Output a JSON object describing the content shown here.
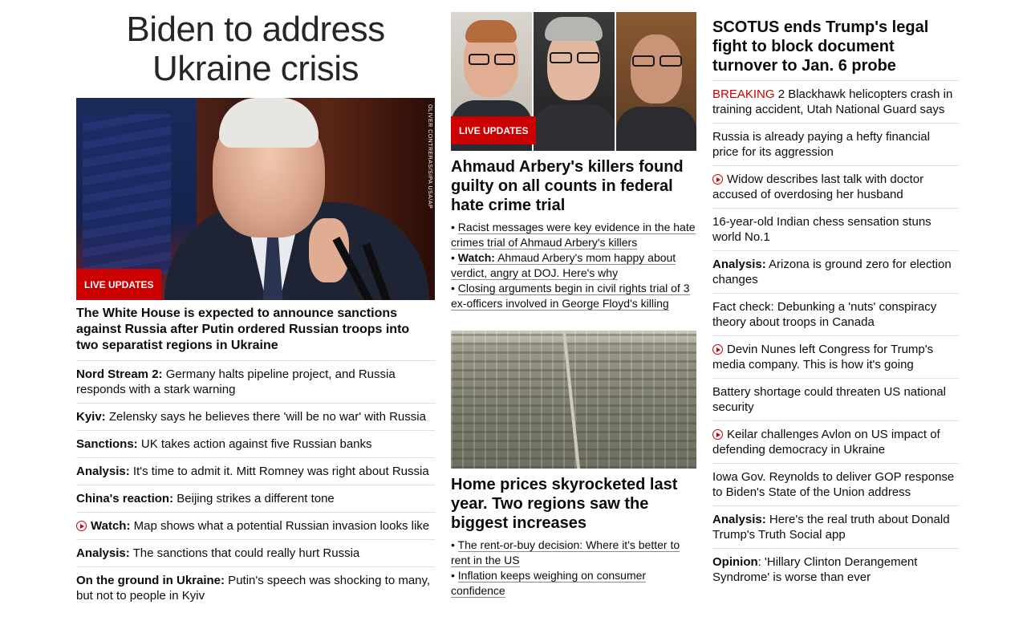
{
  "col1": {
    "title": "Biden to address Ukraine crisis",
    "image_credit": "OLIVER CONTRERAS/SIPA USA/AP",
    "badge": "LIVE UPDATES",
    "lead": "The White House is expected to announce sanctions against Russia after Putin ordered Russian troops into two separatist regions in Ukraine",
    "items": [
      {
        "label": "Nord Stream 2:",
        "text": " Germany halts pipeline project, and Russia responds with a stark warning",
        "video": false
      },
      {
        "label": "Kyiv:",
        "text": " Zelensky says he believes there 'will be no war' with Russia",
        "video": false
      },
      {
        "label": "Sanctions:",
        "text": " UK takes action against five Russian banks",
        "video": false
      },
      {
        "label": "Analysis:",
        "text": " It's time to admit it. Mitt Romney was right about Russia",
        "video": false
      },
      {
        "label": "China's reaction:",
        "text": " Beijing strikes a different tone",
        "video": false
      },
      {
        "label": "Watch:",
        "text": " Map shows what a potential Russian invasion looks like",
        "video": true
      },
      {
        "label": "Analysis:",
        "text": " The sanctions that could really hurt Russia",
        "video": false
      },
      {
        "label": "On the ground in Ukraine:",
        "text": " Putin's speech was shocking to many, but not to people in Kyiv",
        "video": false
      }
    ]
  },
  "col2": {
    "story1": {
      "badge": "LIVE UPDATES",
      "headline": "Ahmaud Arbery's killers found guilty on all counts in federal hate crime trial",
      "subs": [
        {
          "label": "",
          "text": "Racist messages were key evidence in the hate crimes trial of Ahmaud Arbery's killers"
        },
        {
          "label": "Watch:",
          "text": " Ahmaud Arbery's mom happy about verdict, angry at DOJ. Here's why"
        },
        {
          "label": "",
          "text": "Closing arguments begin in civil rights trial of 3 ex-officers involved in George Floyd's killing"
        }
      ]
    },
    "story2": {
      "headline": "Home prices skyrocketed last year. Two regions saw the biggest increases",
      "subs": [
        {
          "label": "",
          "text": "The rent-or-buy decision: Where it's better to rent in the US"
        },
        {
          "label": "",
          "text": "Inflation keeps weighing on consumer confidence"
        }
      ]
    }
  },
  "col3": {
    "headline": "SCOTUS ends Trump's legal fight to block document turnover to Jan. 6 probe",
    "items": [
      {
        "prefix": "BREAKING",
        "label": "",
        "text": " 2 Blackhawk helicopters crash in training accident, Utah National Guard says",
        "video": false
      },
      {
        "prefix": "",
        "label": "",
        "text": "Russia is already paying a hefty financial price for its aggression",
        "video": false
      },
      {
        "prefix": "",
        "label": "",
        "text": "Widow describes last talk with doctor accused of overdosing her husband",
        "video": true
      },
      {
        "prefix": "",
        "label": "",
        "text": "16-year-old Indian chess sensation stuns world No.1",
        "video": false
      },
      {
        "prefix": "",
        "label": "Analysis:",
        "text": " Arizona is ground zero for election changes",
        "video": false
      },
      {
        "prefix": "",
        "label": "",
        "text": "Fact check: Debunking a 'nuts' conspiracy theory about troops in Canada",
        "video": false
      },
      {
        "prefix": "",
        "label": "",
        "text": "Devin Nunes left Congress for Trump's media company. This is how it's going",
        "video": true
      },
      {
        "prefix": "",
        "label": "",
        "text": "Battery shortage could threaten US national security",
        "video": false
      },
      {
        "prefix": "",
        "label": "",
        "text": "Keilar challenges Avlon on US impact of defending democracy in Ukraine",
        "video": true
      },
      {
        "prefix": "",
        "label": "",
        "text": "Iowa Gov. Reynolds to deliver GOP response to Biden's State of the Union address",
        "video": false
      },
      {
        "prefix": "",
        "label": "Analysis:",
        "text": " Here's the real truth about Donald Trump's Truth Social app",
        "video": false
      },
      {
        "prefix": "",
        "label": "Opinion",
        "text": ": 'Hillary Clinton Derangement Syndrome' is worse than ever",
        "video": false
      }
    ]
  },
  "colors": {
    "accent": "#cc0000",
    "divider": "#e1e1e1"
  }
}
